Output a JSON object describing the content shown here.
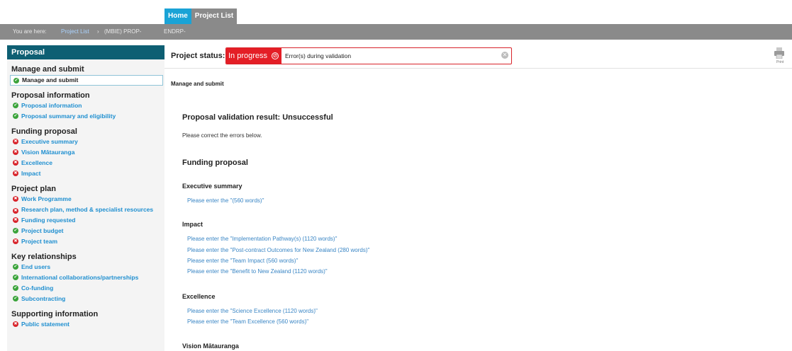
{
  "top_nav": {
    "tabs": [
      "Home",
      "Project List"
    ]
  },
  "breadcrumb": {
    "prefix": "You are here:",
    "link": "Project List",
    "sep": "›",
    "mid": "(MBIE) PROP-",
    "end": "ENDRP-"
  },
  "sidebar": {
    "header": "Proposal",
    "manage": {
      "title": "Manage and submit",
      "item": "Manage and submit"
    },
    "proposal_info": {
      "title": "Proposal information",
      "items": [
        "Proposal information",
        "Proposal summary and eligibility"
      ]
    },
    "funding": {
      "title": "Funding proposal",
      "items": [
        "Executive summary",
        "Vision Mātauranga",
        "Excellence",
        "Impact"
      ]
    },
    "plan": {
      "title": "Project plan",
      "items": [
        "Work Programme",
        "Research plan, method & specialist resources",
        "Funding requested",
        "Project budget",
        "Project team"
      ]
    },
    "relationships": {
      "title": "Key relationships",
      "items": [
        "End users",
        "International collaborations/partnerships",
        "Co-funding",
        "Subcontracting"
      ]
    },
    "supporting": {
      "title": "Supporting information",
      "items": [
        "Public statement"
      ]
    }
  },
  "status": {
    "label": "Project status:",
    "badge": "In progress",
    "message": "Error(s) during validation",
    "print_label": "Print",
    "colors": {
      "badge": "#e41e26",
      "accent": "#1aa3d6",
      "ok": "#3aa33a",
      "error": "#d8232a"
    }
  },
  "main": {
    "crumb_title": "Manage and submit",
    "validation_heading": "Proposal validation result: Unsuccessful",
    "instruction": "Please correct the errors below.",
    "funding_heading": "Funding proposal",
    "sections": [
      {
        "title": "Executive summary",
        "errors": [
          "Please enter the \"(560 words)\""
        ]
      },
      {
        "title": "Impact",
        "errors": [
          "Please enter the \"Implementation Pathway(s) (1120 words)\"",
          "Please enter the \"Post-contract Outcomes for New Zealand (280 words)\"",
          "Please enter the \"Team Impact (560 words)\"",
          "Please enter the \"Benefit to New Zealand (1120 words)\""
        ]
      },
      {
        "title": "Excellence",
        "errors": [
          "Please enter the \"Science Excellence (1120 words)\"",
          "Please enter the \"Team Excellence (560 words)\""
        ]
      },
      {
        "title": "Vision Mātauranga",
        "errors": []
      }
    ]
  }
}
